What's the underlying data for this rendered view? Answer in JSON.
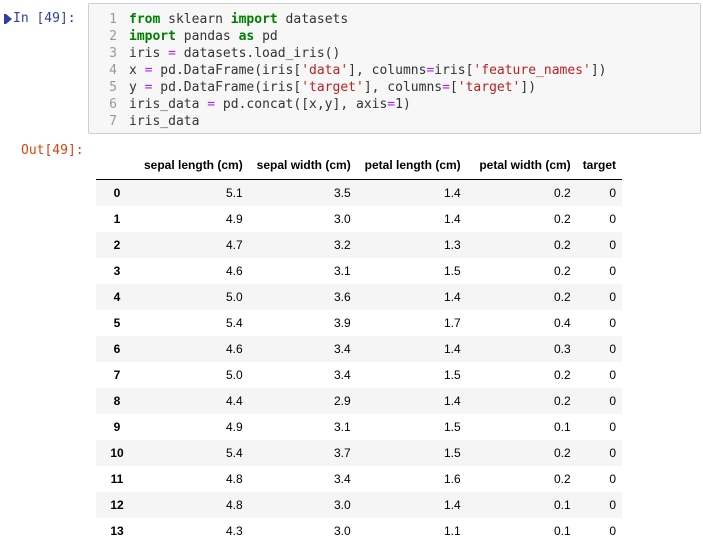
{
  "input_cell": {
    "prompt": "In [49]:",
    "lines": [
      {
        "no": "1",
        "tokens": [
          {
            "t": "from",
            "c": "kw"
          },
          {
            "t": " sklearn ",
            "c": ""
          },
          {
            "t": "import",
            "c": "kw"
          },
          {
            "t": " datasets",
            "c": ""
          }
        ]
      },
      {
        "no": "2",
        "tokens": [
          {
            "t": "import",
            "c": "kw"
          },
          {
            "t": " pandas ",
            "c": ""
          },
          {
            "t": "as",
            "c": "kw"
          },
          {
            "t": " pd",
            "c": ""
          }
        ]
      },
      {
        "no": "3",
        "tokens": [
          {
            "t": "iris ",
            "c": ""
          },
          {
            "t": "=",
            "c": "op"
          },
          {
            "t": " datasets.load_iris()",
            "c": ""
          }
        ]
      },
      {
        "no": "4",
        "tokens": [
          {
            "t": "x ",
            "c": ""
          },
          {
            "t": "=",
            "c": "op"
          },
          {
            "t": " pd.DataFrame(iris[",
            "c": ""
          },
          {
            "t": "'data'",
            "c": "str"
          },
          {
            "t": "], columns",
            "c": ""
          },
          {
            "t": "=",
            "c": "op"
          },
          {
            "t": "iris[",
            "c": ""
          },
          {
            "t": "'feature_names'",
            "c": "str"
          },
          {
            "t": "])",
            "c": ""
          }
        ]
      },
      {
        "no": "5",
        "tokens": [
          {
            "t": "y ",
            "c": ""
          },
          {
            "t": "=",
            "c": "op"
          },
          {
            "t": " pd.DataFrame(iris[",
            "c": ""
          },
          {
            "t": "'target'",
            "c": "str"
          },
          {
            "t": "], columns",
            "c": ""
          },
          {
            "t": "=",
            "c": "op"
          },
          {
            "t": "[",
            "c": ""
          },
          {
            "t": "'target'",
            "c": "str"
          },
          {
            "t": "])",
            "c": ""
          }
        ]
      },
      {
        "no": "6",
        "tokens": [
          {
            "t": "iris_data ",
            "c": ""
          },
          {
            "t": "=",
            "c": "op"
          },
          {
            "t": " pd.concat([x,y], axis",
            "c": ""
          },
          {
            "t": "=",
            "c": "op"
          },
          {
            "t": "1",
            "c": ""
          },
          {
            "t": ")",
            "c": ""
          }
        ]
      },
      {
        "no": "7",
        "tokens": [
          {
            "t": "iris_data",
            "c": ""
          }
        ]
      }
    ]
  },
  "output_cell": {
    "prompt": "Out[49]:",
    "table": {
      "columns": [
        "sepal length (cm)",
        "sepal width (cm)",
        "petal length (cm)",
        "petal width (cm)",
        "target"
      ],
      "rows": [
        {
          "index": "0",
          "values": [
            "5.1",
            "3.5",
            "1.4",
            "0.2",
            "0"
          ]
        },
        {
          "index": "1",
          "values": [
            "4.9",
            "3.0",
            "1.4",
            "0.2",
            "0"
          ]
        },
        {
          "index": "2",
          "values": [
            "4.7",
            "3.2",
            "1.3",
            "0.2",
            "0"
          ]
        },
        {
          "index": "3",
          "values": [
            "4.6",
            "3.1",
            "1.5",
            "0.2",
            "0"
          ]
        },
        {
          "index": "4",
          "values": [
            "5.0",
            "3.6",
            "1.4",
            "0.2",
            "0"
          ]
        },
        {
          "index": "5",
          "values": [
            "5.4",
            "3.9",
            "1.7",
            "0.4",
            "0"
          ]
        },
        {
          "index": "6",
          "values": [
            "4.6",
            "3.4",
            "1.4",
            "0.3",
            "0"
          ]
        },
        {
          "index": "7",
          "values": [
            "5.0",
            "3.4",
            "1.5",
            "0.2",
            "0"
          ]
        },
        {
          "index": "8",
          "values": [
            "4.4",
            "2.9",
            "1.4",
            "0.2",
            "0"
          ]
        },
        {
          "index": "9",
          "values": [
            "4.9",
            "3.1",
            "1.5",
            "0.1",
            "0"
          ]
        },
        {
          "index": "10",
          "values": [
            "5.4",
            "3.7",
            "1.5",
            "0.2",
            "0"
          ]
        },
        {
          "index": "11",
          "values": [
            "4.8",
            "3.4",
            "1.6",
            "0.2",
            "0"
          ]
        },
        {
          "index": "12",
          "values": [
            "4.8",
            "3.0",
            "1.4",
            "0.1",
            "0"
          ]
        },
        {
          "index": "13",
          "values": [
            "4.3",
            "3.0",
            "1.1",
            "0.1",
            "0"
          ]
        }
      ]
    }
  },
  "colors": {
    "prompt_in": "#303f9f",
    "prompt_out": "#d84315",
    "keyword": "#008000",
    "string": "#ba2121",
    "operator": "#aa22ff"
  }
}
